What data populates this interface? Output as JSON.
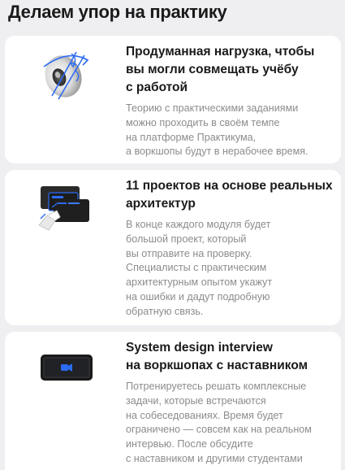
{
  "page": {
    "title": "Делаем упор на практику"
  },
  "cards": [
    {
      "icon": "rotating-disc-icon",
      "title": "Продуманная нагрузка, чтобы\nвы могли совмещать учёбу\nс работой",
      "description": "Теорию с практическими заданиями\nможно проходить в своём темпе\nна платформе Практикума,\nа воркшопы будут в нерабочее время."
    },
    {
      "icon": "architecture-blocks-icon",
      "title": "11 проектов на основе реальных\nархитектур",
      "description": "В конце каждого модуля будет\nбольшой проект, который\nвы отправите на проверку.\nСпециалисты с практическим\nархитектурным опытом укажут\nна ошибки и дадут подробную\nобратную связь."
    },
    {
      "icon": "video-call-icon",
      "title": "System design interview\nна воркшопах с наставником",
      "description": "Потренируетесь решать комплексные\nзадачи, которые встречаются\nна собеседованиях. Время будет\nограничено — совсем как на реальном\nинтервью. После обсудите\nс наставником и другими студентами"
    }
  ],
  "colors": {
    "background": "#efeff2",
    "card": "#ffffff",
    "title": "#1a1a1a",
    "description": "#8c8c8c",
    "accent": "#2c6bf2"
  }
}
